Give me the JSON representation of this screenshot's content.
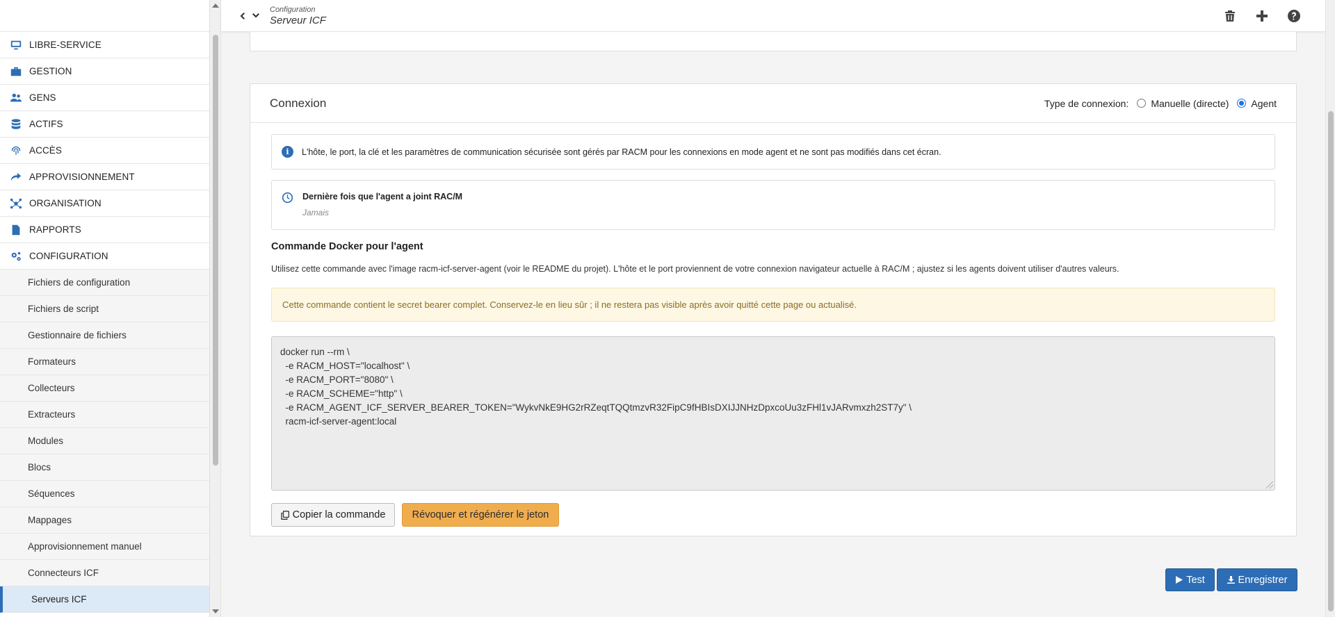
{
  "header": {
    "breadcrumb": "Configuration",
    "title": "Serveur ICF"
  },
  "sidebar": {
    "sections": [
      {
        "label": "LIBRE-SERVICE",
        "icon": "monitor-icon"
      },
      {
        "label": "GESTION",
        "icon": "briefcase-icon"
      },
      {
        "label": "GENS",
        "icon": "users-icon"
      },
      {
        "label": "ACTIFS",
        "icon": "database-icon"
      },
      {
        "label": "ACCÈS",
        "icon": "fingerprint-icon"
      },
      {
        "label": "APPROVISIONNEMENT",
        "icon": "share-icon"
      },
      {
        "label": "ORGANISATION",
        "icon": "network-icon"
      },
      {
        "label": "RAPPORTS",
        "icon": "file-icon"
      },
      {
        "label": "CONFIGURATION",
        "icon": "gears-icon"
      }
    ],
    "sub_items": [
      "Fichiers de configuration",
      "Fichiers de script",
      "Gestionnaire de fichiers",
      "Formateurs",
      "Collecteurs",
      "Extracteurs",
      "Modules",
      "Blocs",
      "Séquences",
      "Mappages",
      "Approvisionnement manuel",
      "Connecteurs ICF",
      "Serveurs ICF"
    ],
    "active_item": "Serveurs ICF"
  },
  "connexion": {
    "title": "Connexion",
    "type_label": "Type de connexion:",
    "options": [
      "Manuelle (directe)",
      "Agent"
    ],
    "selected": "Agent",
    "info": "L'hôte, le port, la clé et les paramètres de communication sécurisée sont gérés par RACM pour les connexions en mode agent et ne sont pas modifiés dans cet écran.",
    "last_seen_label": "Dernière fois que l'agent a joint RAC/M",
    "last_seen_value": "Jamais",
    "docker_title": "Commande Docker pour l'agent",
    "docker_desc": "Utilisez cette commande avec l'image racm-icf-server-agent (voir le README du projet). L'hôte et le port proviennent de votre connexion navigateur actuelle à RAC/M ; ajustez si les agents doivent utiliser d'autres valeurs.",
    "warning": "Cette commande contient le secret bearer complet. Conservez-le en lieu sûr ; il ne restera pas visible après avoir quitté cette page ou actualisé.",
    "command": "docker run --rm \\\n  -e RACM_HOST=\"localhost\" \\\n  -e RACM_PORT=\"8080\" \\\n  -e RACM_SCHEME=\"http\" \\\n  -e RACM_AGENT_ICF_SERVER_BEARER_TOKEN=\"WykvNkE9HG2rRZeqtTQQtmzvR32FipC9fHBIsDXIJJNHzDpxcoUu3zFHl1vJARvmxzh2ST7y\" \\\n  racm-icf-server-agent:local",
    "copy_label": "Copier la commande",
    "revoke_label": "Révoquer et régénérer le jeton"
  },
  "footer": {
    "test_label": "Test",
    "save_label": "Enregistrer"
  },
  "colors": {
    "accent": "#2d6db5",
    "warning_bg": "#fdf7e4",
    "revoke_button": "#f0ad4e"
  }
}
